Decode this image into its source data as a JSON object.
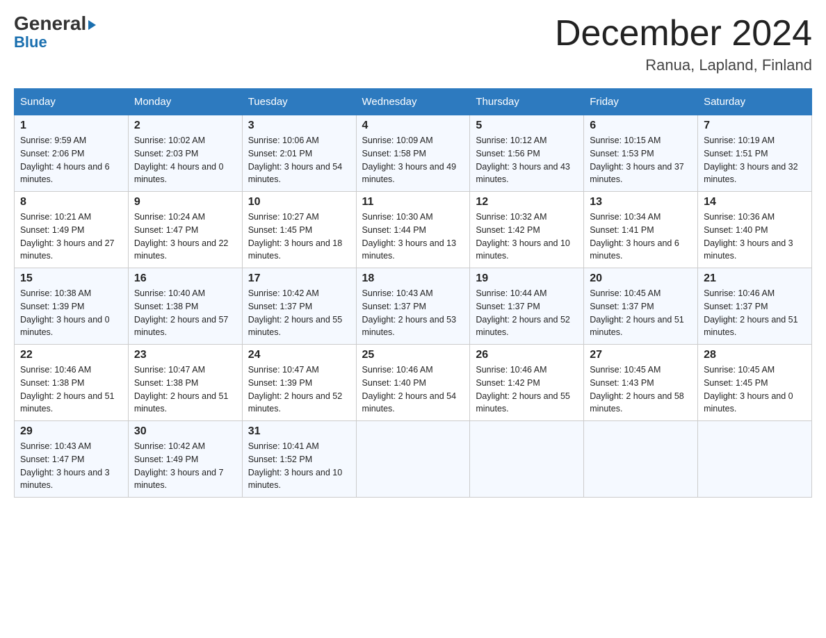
{
  "logo": {
    "line1": "General",
    "triangle": "▶",
    "line2": "Blue"
  },
  "title": "December 2024",
  "location": "Ranua, Lapland, Finland",
  "weekdays": [
    "Sunday",
    "Monday",
    "Tuesday",
    "Wednesday",
    "Thursday",
    "Friday",
    "Saturday"
  ],
  "weeks": [
    [
      {
        "day": "1",
        "sunrise": "9:59 AM",
        "sunset": "2:06 PM",
        "daylight": "4 hours and 6 minutes."
      },
      {
        "day": "2",
        "sunrise": "10:02 AM",
        "sunset": "2:03 PM",
        "daylight": "4 hours and 0 minutes."
      },
      {
        "day": "3",
        "sunrise": "10:06 AM",
        "sunset": "2:01 PM",
        "daylight": "3 hours and 54 minutes."
      },
      {
        "day": "4",
        "sunrise": "10:09 AM",
        "sunset": "1:58 PM",
        "daylight": "3 hours and 49 minutes."
      },
      {
        "day": "5",
        "sunrise": "10:12 AM",
        "sunset": "1:56 PM",
        "daylight": "3 hours and 43 minutes."
      },
      {
        "day": "6",
        "sunrise": "10:15 AM",
        "sunset": "1:53 PM",
        "daylight": "3 hours and 37 minutes."
      },
      {
        "day": "7",
        "sunrise": "10:19 AM",
        "sunset": "1:51 PM",
        "daylight": "3 hours and 32 minutes."
      }
    ],
    [
      {
        "day": "8",
        "sunrise": "10:21 AM",
        "sunset": "1:49 PM",
        "daylight": "3 hours and 27 minutes."
      },
      {
        "day": "9",
        "sunrise": "10:24 AM",
        "sunset": "1:47 PM",
        "daylight": "3 hours and 22 minutes."
      },
      {
        "day": "10",
        "sunrise": "10:27 AM",
        "sunset": "1:45 PM",
        "daylight": "3 hours and 18 minutes."
      },
      {
        "day": "11",
        "sunrise": "10:30 AM",
        "sunset": "1:44 PM",
        "daylight": "3 hours and 13 minutes."
      },
      {
        "day": "12",
        "sunrise": "10:32 AM",
        "sunset": "1:42 PM",
        "daylight": "3 hours and 10 minutes."
      },
      {
        "day": "13",
        "sunrise": "10:34 AM",
        "sunset": "1:41 PM",
        "daylight": "3 hours and 6 minutes."
      },
      {
        "day": "14",
        "sunrise": "10:36 AM",
        "sunset": "1:40 PM",
        "daylight": "3 hours and 3 minutes."
      }
    ],
    [
      {
        "day": "15",
        "sunrise": "10:38 AM",
        "sunset": "1:39 PM",
        "daylight": "3 hours and 0 minutes."
      },
      {
        "day": "16",
        "sunrise": "10:40 AM",
        "sunset": "1:38 PM",
        "daylight": "2 hours and 57 minutes."
      },
      {
        "day": "17",
        "sunrise": "10:42 AM",
        "sunset": "1:37 PM",
        "daylight": "2 hours and 55 minutes."
      },
      {
        "day": "18",
        "sunrise": "10:43 AM",
        "sunset": "1:37 PM",
        "daylight": "2 hours and 53 minutes."
      },
      {
        "day": "19",
        "sunrise": "10:44 AM",
        "sunset": "1:37 PM",
        "daylight": "2 hours and 52 minutes."
      },
      {
        "day": "20",
        "sunrise": "10:45 AM",
        "sunset": "1:37 PM",
        "daylight": "2 hours and 51 minutes."
      },
      {
        "day": "21",
        "sunrise": "10:46 AM",
        "sunset": "1:37 PM",
        "daylight": "2 hours and 51 minutes."
      }
    ],
    [
      {
        "day": "22",
        "sunrise": "10:46 AM",
        "sunset": "1:38 PM",
        "daylight": "2 hours and 51 minutes."
      },
      {
        "day": "23",
        "sunrise": "10:47 AM",
        "sunset": "1:38 PM",
        "daylight": "2 hours and 51 minutes."
      },
      {
        "day": "24",
        "sunrise": "10:47 AM",
        "sunset": "1:39 PM",
        "daylight": "2 hours and 52 minutes."
      },
      {
        "day": "25",
        "sunrise": "10:46 AM",
        "sunset": "1:40 PM",
        "daylight": "2 hours and 54 minutes."
      },
      {
        "day": "26",
        "sunrise": "10:46 AM",
        "sunset": "1:42 PM",
        "daylight": "2 hours and 55 minutes."
      },
      {
        "day": "27",
        "sunrise": "10:45 AM",
        "sunset": "1:43 PM",
        "daylight": "2 hours and 58 minutes."
      },
      {
        "day": "28",
        "sunrise": "10:45 AM",
        "sunset": "1:45 PM",
        "daylight": "3 hours and 0 minutes."
      }
    ],
    [
      {
        "day": "29",
        "sunrise": "10:43 AM",
        "sunset": "1:47 PM",
        "daylight": "3 hours and 3 minutes."
      },
      {
        "day": "30",
        "sunrise": "10:42 AM",
        "sunset": "1:49 PM",
        "daylight": "3 hours and 7 minutes."
      },
      {
        "day": "31",
        "sunrise": "10:41 AM",
        "sunset": "1:52 PM",
        "daylight": "3 hours and 10 minutes."
      },
      null,
      null,
      null,
      null
    ]
  ]
}
